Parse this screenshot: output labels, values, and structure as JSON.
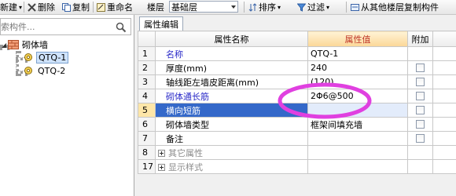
{
  "toolbar": {
    "new_label": "新建",
    "delete_label": "删除",
    "copy_label": "复制",
    "rename_label": "重命名",
    "floor_label": "楼层",
    "floor_value": "基础层",
    "sort_label": "排序",
    "filter_label": "过滤",
    "copy_from_floor_label": "从其他楼层复制构件"
  },
  "left_panel": {
    "search_placeholder": "索构件...",
    "tree": {
      "root_label": "砌体墙",
      "children": [
        "QTQ-1",
        "QTQ-2"
      ],
      "selected": "QTQ-1"
    }
  },
  "right_panel": {
    "tab_label": "属性编辑",
    "columns": {
      "name": "属性名称",
      "value": "属性值",
      "extra": "附加"
    },
    "rows": [
      {
        "num": "1",
        "name": "名称",
        "value": "QTQ-1",
        "name_color": "blue",
        "checkbox": false
      },
      {
        "num": "2",
        "name": "厚度(mm)",
        "value": "240",
        "name_color": "black",
        "checkbox": true
      },
      {
        "num": "3",
        "name": "轴线距左墙皮距离(mm)",
        "value": "(120)",
        "name_color": "black",
        "checkbox": true
      },
      {
        "num": "4",
        "name": "砌体通长筋",
        "value": "2Φ6@500",
        "name_color": "blue",
        "checkbox": true
      },
      {
        "num": "5",
        "name": "横向短筋",
        "value": "",
        "name_color": "blue",
        "checkbox": true,
        "selected": true
      },
      {
        "num": "6",
        "name": "砌体墙类型",
        "value": "框架间填充墙",
        "name_color": "black",
        "checkbox": true
      },
      {
        "num": "7",
        "name": "备注",
        "value": "",
        "name_color": "black",
        "checkbox": true
      },
      {
        "num": "8",
        "name": "其它属性",
        "value": "",
        "name_color": "gray",
        "group": true
      },
      {
        "num": "17",
        "name": "显示样式",
        "value": "",
        "name_color": "gray",
        "group": true
      }
    ]
  },
  "colors": {
    "annotation": "#e040e0",
    "selection": "#3468c9",
    "header_value": "#c0392b"
  }
}
